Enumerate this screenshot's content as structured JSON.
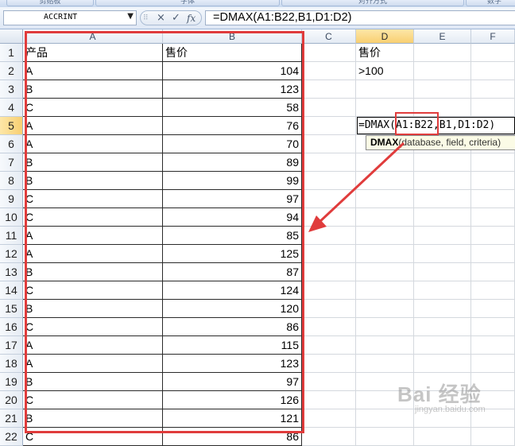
{
  "ribbon": {
    "tabs": [
      "剪贴板",
      "字体",
      "对齐方式",
      "数字"
    ]
  },
  "formula_bar": {
    "name_box": "ACCRINT",
    "formula": "=DMAX(A1:B22,B1,D1:D2)",
    "cancel_icon": "×",
    "enter_icon": "✓",
    "fx_label": "fx"
  },
  "columns": [
    "A",
    "B",
    "C",
    "D",
    "E",
    "F"
  ],
  "rows": [
    "1",
    "2",
    "3",
    "4",
    "5",
    "6",
    "7",
    "8",
    "9",
    "10",
    "11",
    "12",
    "13",
    "14",
    "15",
    "16",
    "17",
    "18",
    "19",
    "20",
    "21",
    "22"
  ],
  "table": {
    "header": {
      "product": "产品",
      "price": "售价"
    },
    "data": [
      {
        "p": "A",
        "v": "104"
      },
      {
        "p": "B",
        "v": "123"
      },
      {
        "p": "C",
        "v": "58"
      },
      {
        "p": "A",
        "v": "76"
      },
      {
        "p": "A",
        "v": "70"
      },
      {
        "p": "B",
        "v": "89"
      },
      {
        "p": "B",
        "v": "99"
      },
      {
        "p": "C",
        "v": "97"
      },
      {
        "p": "C",
        "v": "94"
      },
      {
        "p": "A",
        "v": "85"
      },
      {
        "p": "A",
        "v": "125"
      },
      {
        "p": "B",
        "v": "87"
      },
      {
        "p": "C",
        "v": "124"
      },
      {
        "p": "B",
        "v": "120"
      },
      {
        "p": "C",
        "v": "86"
      },
      {
        "p": "A",
        "v": "115"
      },
      {
        "p": "A",
        "v": "123"
      },
      {
        "p": "B",
        "v": "97"
      },
      {
        "p": "C",
        "v": "126"
      },
      {
        "p": "B",
        "v": "121"
      },
      {
        "p": "C",
        "v": "86"
      }
    ]
  },
  "criteria": {
    "header": "售价",
    "value": ">100"
  },
  "editing_cell": {
    "text": "=DMAX(A1:B22,B1,D1:D2)"
  },
  "tooltip": {
    "func": "DMAX",
    "args": "(database, field, criteria)"
  },
  "watermark": {
    "brand": "Bai 经验",
    "url": "jingyan.baidu.com"
  },
  "colors": {
    "highlight": "#e03c3c",
    "selected_header": "#f8cf71"
  }
}
